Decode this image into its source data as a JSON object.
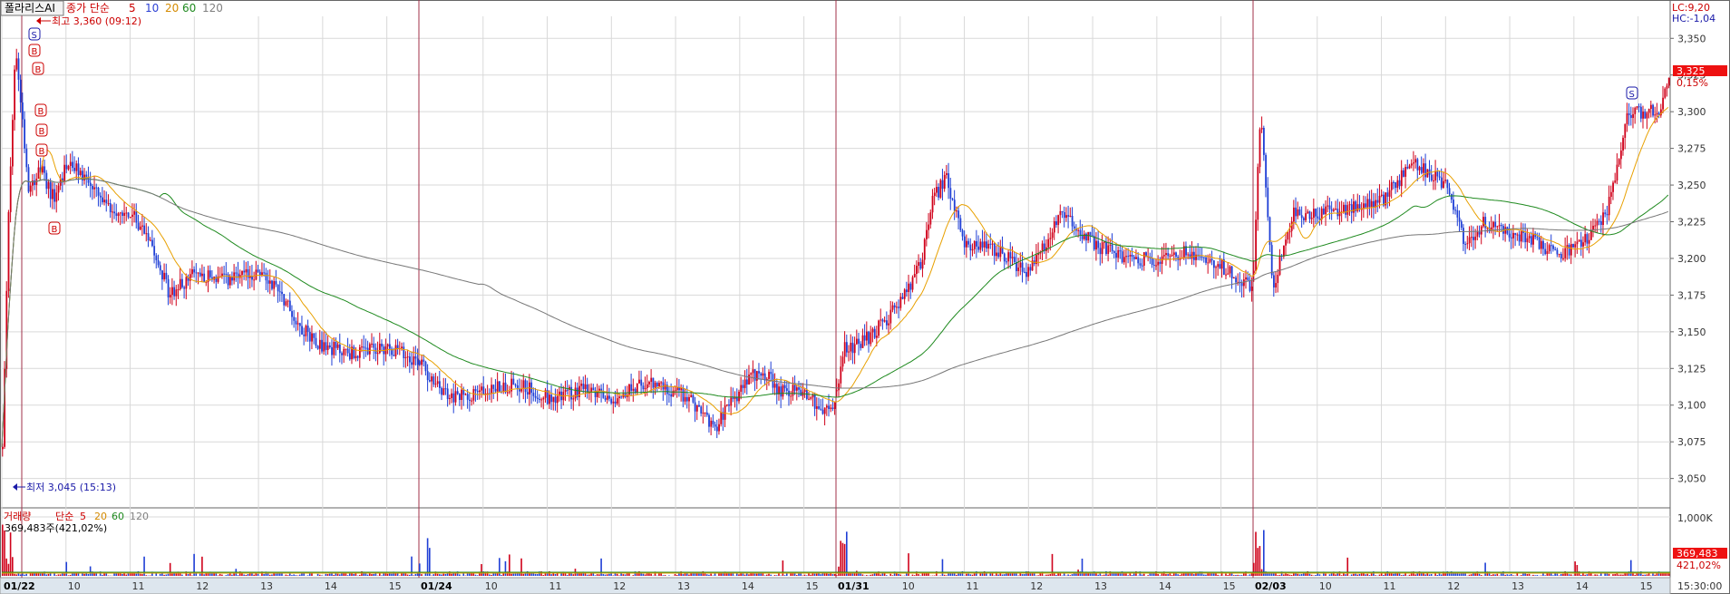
{
  "header": {
    "stock_name": "폴라리스AI",
    "price_ma_label": "종가 단순",
    "ma_periods": [
      "5",
      "10",
      "20",
      "60",
      "120"
    ],
    "ma_colors": [
      "#e8a000",
      "#5b2bd9",
      "#e8a000",
      "#1f8a1f",
      "#808080"
    ],
    "label_colors": [
      "#cc0000",
      "#2a3fd4",
      "#d48a00",
      "#1f8a1f",
      "#808080"
    ]
  },
  "right_header": {
    "lc": "LC:9,20",
    "hc": "HC:-1,04"
  },
  "annotations": {
    "high": "최고 3,360 (09:12)",
    "low": "최저 3,045 (15:13)",
    "s_marker": "S",
    "b_marker": "B"
  },
  "current": {
    "price": "3,325",
    "change": "0,15%"
  },
  "volume_panel": {
    "label": "거래량",
    "ma_label": "단순",
    "ma_periods": [
      "5",
      "20",
      "60",
      "120"
    ],
    "value_text": "369,483주(421,02%)",
    "axis_label": "1,000K",
    "current_value": "369,483",
    "current_pct": "421,02%"
  },
  "x_axis": {
    "ticks": [
      "01/22",
      "10",
      "11",
      "12",
      "13",
      "14",
      "15",
      "01/24",
      "10",
      "11",
      "12",
      "13",
      "14",
      "15",
      "01/31",
      "10",
      "11",
      "12",
      "13",
      "14",
      "15",
      "02/03",
      "10",
      "11",
      "12",
      "13",
      "14",
      "15"
    ],
    "day_starts": [
      0,
      7,
      14,
      21
    ],
    "end_time": "15:30:00"
  },
  "chart_data": {
    "type": "candlestick",
    "interval": "1-minute",
    "days": [
      "01/22",
      "01/24",
      "01/31",
      "02/03"
    ],
    "y_ticks": [
      "3,350",
      "3,325",
      "3,300",
      "3,275",
      "3,250",
      "3,225",
      "3,200",
      "3,175",
      "3,150",
      "3,125",
      "3,100",
      "3,075",
      "3,050"
    ],
    "ylim": [
      3030,
      3365
    ],
    "series": [
      {
        "name": "01/22",
        "t": [
          9.0,
          9.1,
          9.2,
          9.3,
          9.4,
          9.6,
          9.8,
          10.0,
          10.3,
          10.6,
          11.0,
          11.3,
          11.6,
          12.0,
          12.5,
          13.0,
          13.3,
          13.6,
          14.0,
          14.5,
          15.0,
          15.5
        ],
        "close": [
          3070,
          3240,
          3345,
          3300,
          3250,
          3260,
          3240,
          3265,
          3255,
          3235,
          3230,
          3215,
          3175,
          3190,
          3185,
          3190,
          3180,
          3155,
          3140,
          3135,
          3140,
          3130
        ]
      },
      {
        "name": "01/24",
        "t": [
          9.0,
          9.2,
          9.5,
          10.0,
          10.5,
          11.0,
          11.5,
          12.0,
          12.5,
          13.0,
          13.3,
          13.6,
          14.0,
          14.3,
          14.6,
          15.0,
          15.3,
          15.5
        ],
        "close": [
          3130,
          3115,
          3105,
          3110,
          3115,
          3105,
          3110,
          3105,
          3115,
          3110,
          3100,
          3085,
          3110,
          3125,
          3110,
          3110,
          3095,
          3100
        ]
      },
      {
        "name": "01/31",
        "t": [
          9.0,
          9.1,
          9.3,
          9.6,
          10.0,
          10.3,
          10.5,
          10.7,
          11.0,
          11.5,
          12.0,
          12.5,
          13.0,
          13.5,
          14.0,
          14.5,
          15.0,
          15.3,
          15.5
        ],
        "close": [
          3110,
          3140,
          3140,
          3150,
          3170,
          3195,
          3240,
          3255,
          3210,
          3205,
          3190,
          3230,
          3210,
          3200,
          3200,
          3205,
          3195,
          3185,
          3180
        ]
      },
      {
        "name": "02/03",
        "t": [
          9.0,
          9.1,
          9.3,
          9.6,
          10.0,
          10.5,
          11.0,
          11.5,
          12.0,
          12.3,
          12.6,
          13.0,
          13.3,
          13.6,
          14.0,
          14.5,
          14.8,
          15.0,
          15.3,
          15.5
        ],
        "close": [
          3190,
          3300,
          3180,
          3230,
          3230,
          3235,
          3240,
          3265,
          3250,
          3210,
          3225,
          3215,
          3215,
          3205,
          3205,
          3230,
          3295,
          3300,
          3300,
          3325
        ]
      }
    ],
    "volume_max": 1000000
  }
}
